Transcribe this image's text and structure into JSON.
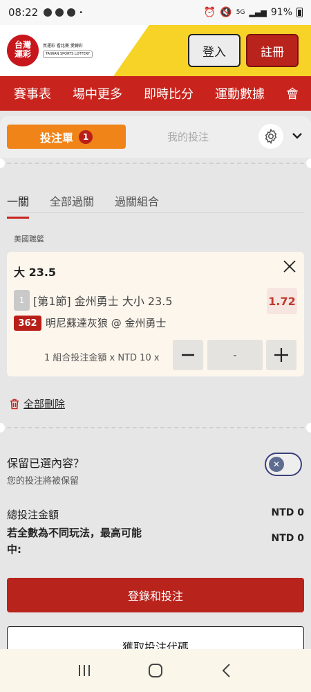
{
  "status_bar": {
    "time": "08:22",
    "battery": "91%",
    "network": "5G"
  },
  "header": {
    "logo_text": "台灣運彩",
    "logo_tagline": "買運彩 看比賽 愛轉彩",
    "logo_tagline_en": "TAIWAN SPORTS LOTTERY",
    "login_label": "登入",
    "register_label": "註冊"
  },
  "nav": {
    "items": [
      "賽事表",
      "場中更多",
      "即時比分",
      "運動數據",
      "會"
    ]
  },
  "betslip": {
    "slip_tab_label": "投注單",
    "slip_count": "1",
    "my_bets_label": "我的投注",
    "bet_types": [
      "一關",
      "全部過關",
      "過關組合"
    ],
    "league": "美國職籃",
    "selection": {
      "title": "大 23.5",
      "leg_number": "1",
      "market": "[第1節] 金州勇士 大小 23.5",
      "odds": "1.72",
      "match_id": "362",
      "match": "明尼蘇達灰狼 @ 金州勇士",
      "stake_label": "1 組合投注金額 x NTD 10 x",
      "stake_value": "-"
    },
    "delete_all_label": "全部刪除",
    "retain": {
      "title": "保留已選內容？",
      "subtitle": "您的投注將被保留",
      "enabled": false
    },
    "total_label": "總投注金額",
    "total_value": "NTD 0",
    "max_win_label": "若全數為不同玩法，最高可能中:",
    "max_win_value": "NTD 0",
    "place_bet_label": "登錄和投注",
    "get_code_label": "獲取投注代碼"
  },
  "colors": {
    "brand_red": "#c8241d",
    "accent_orange": "#f08419",
    "odds_red": "#c0392b"
  }
}
